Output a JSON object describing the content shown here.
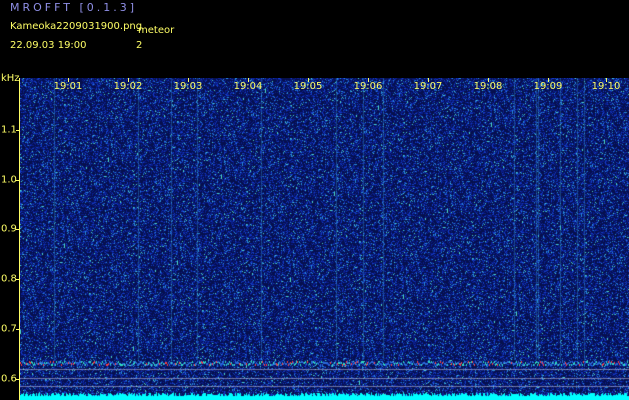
{
  "header": {
    "app_title": "MROFFT [0.1.3]",
    "file_name": "Kameoka2209031900.png",
    "meteor_label": "meteor",
    "date_time": "22.09.03  19:00",
    "meteor_count": "2"
  },
  "axis": {
    "unit": "kHz",
    "y_ticks": [
      "1.1",
      "1.0",
      "0.9",
      "0.8",
      "0.7",
      "0.6"
    ],
    "x_ticks": [
      "19:01",
      "19:02",
      "19:03",
      "19:04",
      "19:05",
      "19:06",
      "19:07",
      "19:08",
      "19:09",
      "19:10"
    ]
  },
  "colors": {
    "background": "#000000",
    "label": "#ffff66",
    "title": "#8f8fe6",
    "spectrogram_base": "#0a1a7a",
    "noise_floor": "#00ffff"
  }
}
